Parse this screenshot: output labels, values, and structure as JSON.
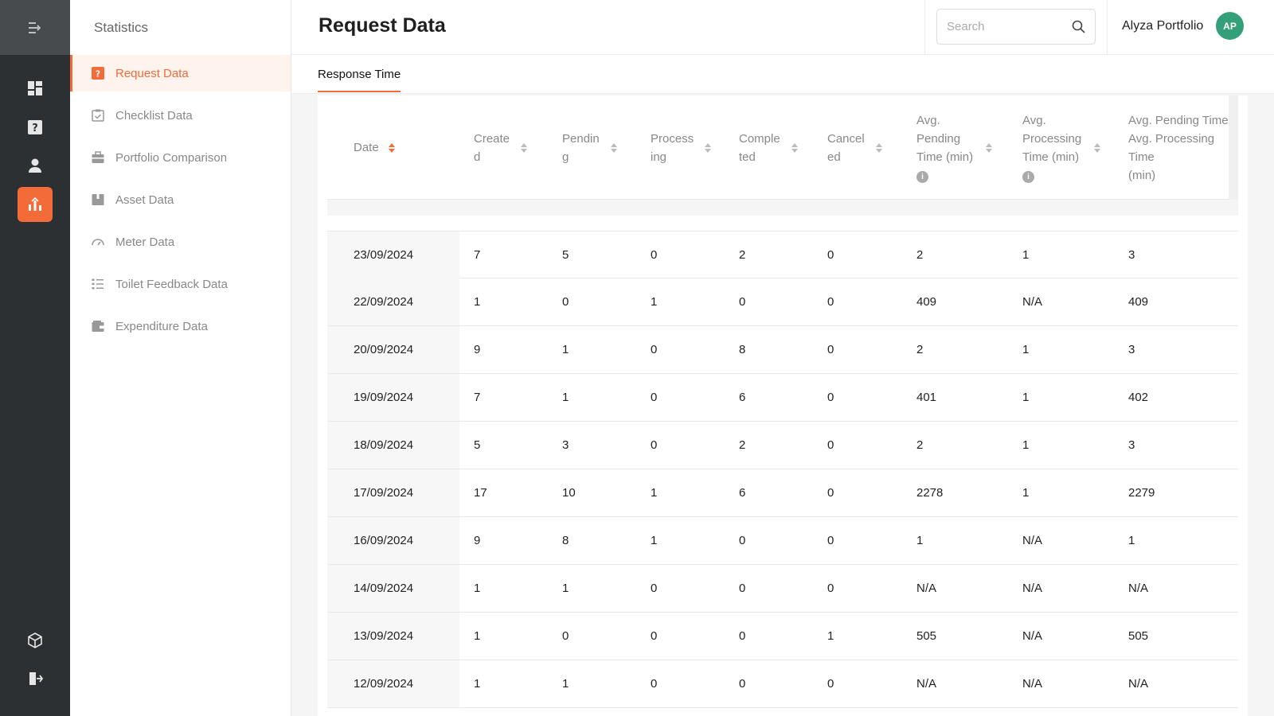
{
  "header": {
    "title": "Request Data",
    "search_placeholder": "Search",
    "user_name": "Alyza Portfolio",
    "user_initials": "AP"
  },
  "rail": {
    "icons": [
      "menu-expand-icon",
      "dashboard-icon",
      "request-icon",
      "user-icon",
      "statistics-icon",
      "package-icon",
      "logout-icon"
    ],
    "active": "statistics-icon"
  },
  "subnav": {
    "title": "Statistics",
    "items": [
      {
        "label": "Request Data",
        "icon": "question-square-icon",
        "active": true
      },
      {
        "label": "Checklist Data",
        "icon": "clipboard-check-icon",
        "active": false
      },
      {
        "label": "Portfolio Comparison",
        "icon": "briefcase-icon",
        "active": false
      },
      {
        "label": "Asset Data",
        "icon": "box-icon",
        "active": false
      },
      {
        "label": "Meter Data",
        "icon": "gauge-icon",
        "active": false
      },
      {
        "label": "Toilet Feedback Data",
        "icon": "list-icon",
        "active": false
      },
      {
        "label": "Expenditure Data",
        "icon": "wallet-icon",
        "active": false
      }
    ]
  },
  "tabs": [
    {
      "label": "Response Time",
      "active": true
    }
  ],
  "table": {
    "columns": [
      {
        "label": "Date",
        "sort": "desc"
      },
      {
        "label": "Create\nd",
        "sort": "none"
      },
      {
        "label": "Pendin\ng",
        "sort": "none"
      },
      {
        "label": "Process\ning",
        "sort": "none"
      },
      {
        "label": "Comple\nted",
        "sort": "none"
      },
      {
        "label": "Cancel\ned",
        "sort": "none"
      },
      {
        "label": "Avg.\nPending\nTime (min)",
        "sort": "none",
        "info": "i"
      },
      {
        "label": "Avg.\nProcessing\nTime (min)",
        "sort": "none",
        "info": "i"
      },
      {
        "label": "Avg. Pending Time\nAvg. Processing Time\n(min)"
      }
    ],
    "rows": [
      [
        "23/09/2024",
        "7",
        "5",
        "0",
        "2",
        "0",
        "2",
        "1",
        "3"
      ],
      [
        "22/09/2024",
        "1",
        "0",
        "1",
        "0",
        "0",
        "409",
        "N/A",
        "409"
      ],
      [
        "20/09/2024",
        "9",
        "1",
        "0",
        "8",
        "0",
        "2",
        "1",
        "3"
      ],
      [
        "19/09/2024",
        "7",
        "1",
        "0",
        "6",
        "0",
        "401",
        "1",
        "402"
      ],
      [
        "18/09/2024",
        "5",
        "3",
        "0",
        "2",
        "0",
        "2",
        "1",
        "3"
      ],
      [
        "17/09/2024",
        "17",
        "10",
        "1",
        "6",
        "0",
        "2278",
        "1",
        "2279"
      ],
      [
        "16/09/2024",
        "9",
        "8",
        "1",
        "0",
        "0",
        "1",
        "N/A",
        "1"
      ],
      [
        "14/09/2024",
        "1",
        "1",
        "0",
        "0",
        "0",
        "N/A",
        "N/A",
        "N/A"
      ],
      [
        "13/09/2024",
        "1",
        "0",
        "0",
        "0",
        "1",
        "505",
        "N/A",
        "505"
      ],
      [
        "12/09/2024",
        "1",
        "1",
        "0",
        "0",
        "0",
        "N/A",
        "N/A",
        "N/A"
      ]
    ]
  }
}
